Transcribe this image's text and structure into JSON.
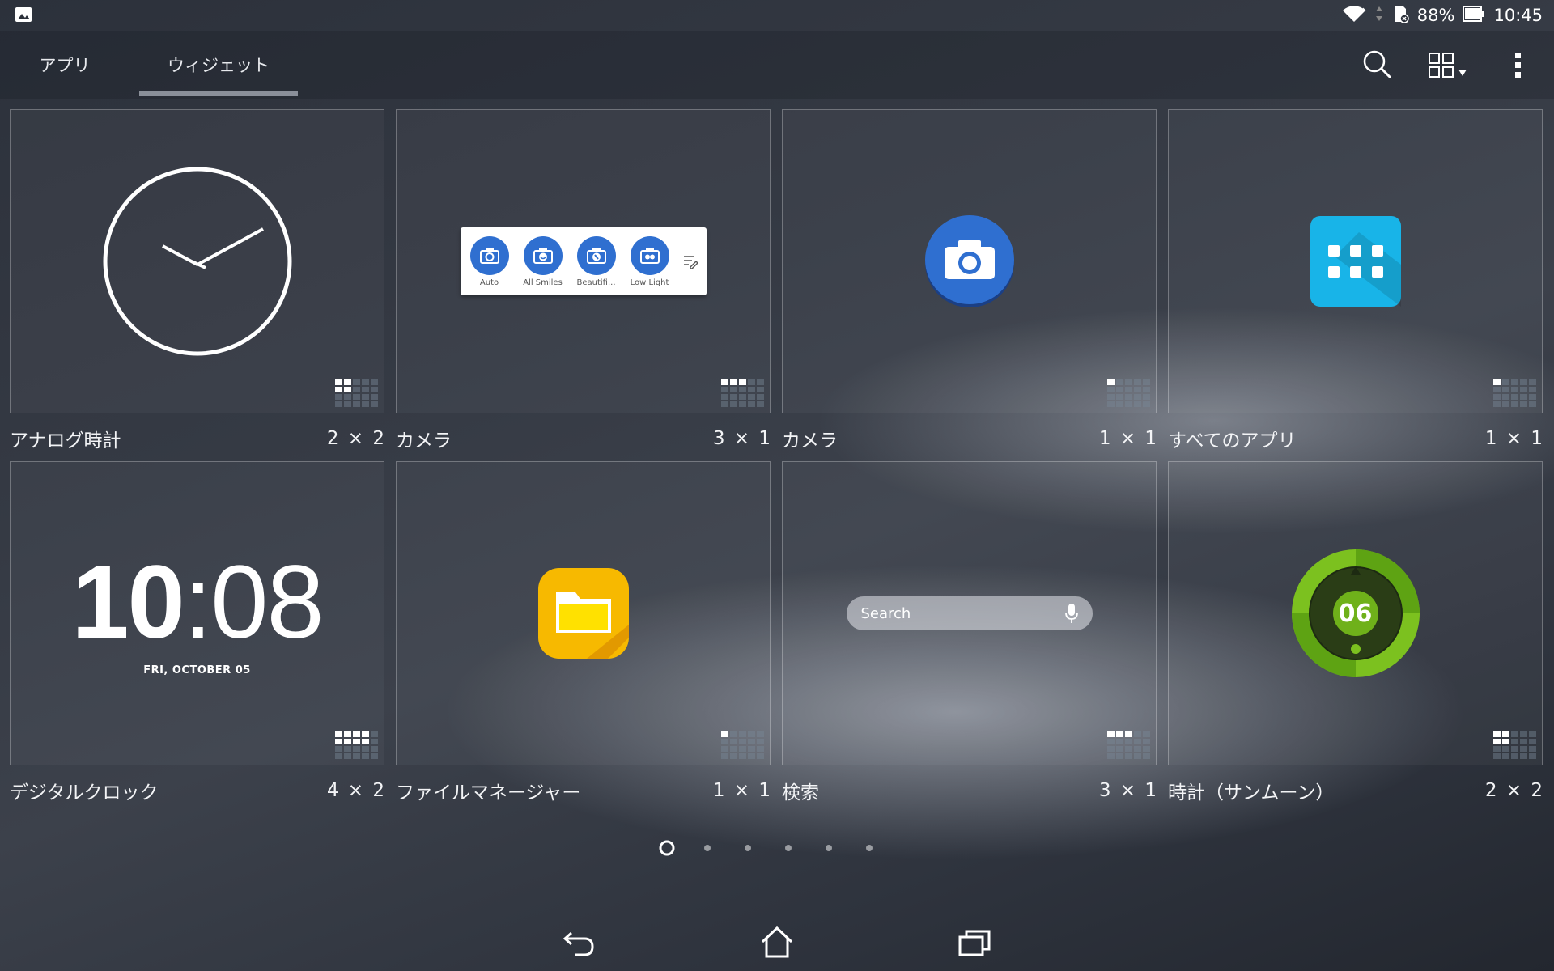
{
  "status_bar": {
    "battery": "88%",
    "time": "10:45"
  },
  "header": {
    "tabs": [
      {
        "label": "アプリ",
        "selected": false
      },
      {
        "label": "ウィジェット",
        "selected": true
      }
    ]
  },
  "widgets": [
    {
      "name": "アナログ時計",
      "size": "2 × 2"
    },
    {
      "name": "カメラ",
      "size": "3 × 1"
    },
    {
      "name": "カメラ",
      "size": "1 × 1"
    },
    {
      "name": "すべてのアプリ",
      "size": "1 × 1"
    },
    {
      "name": "デジタルクロック",
      "size": "4 × 2"
    },
    {
      "name": "ファイルマネージャー",
      "size": "1 × 1"
    },
    {
      "name": "検索",
      "size": "3 × 1"
    },
    {
      "name": "時計（サンムーン）",
      "size": "2 × 2"
    }
  ],
  "camera_modes": [
    "Auto",
    "All Smiles",
    "Beautifi...",
    "Low Light"
  ],
  "digital_clock": {
    "hour": "10",
    "minute": "08",
    "date": "FRI, OCTOBER 05"
  },
  "search_widget": {
    "placeholder": "Search"
  },
  "sun_moon_clock": {
    "value": "06"
  },
  "pagination": {
    "total_pages": 6,
    "current_page": 1
  },
  "colors": {
    "camera_blue": "#2f6fd0",
    "all_apps_cyan": "#18b4e8",
    "file_manager_yellow": "#f7b900",
    "sunmoon_green": "#7cc11f"
  }
}
